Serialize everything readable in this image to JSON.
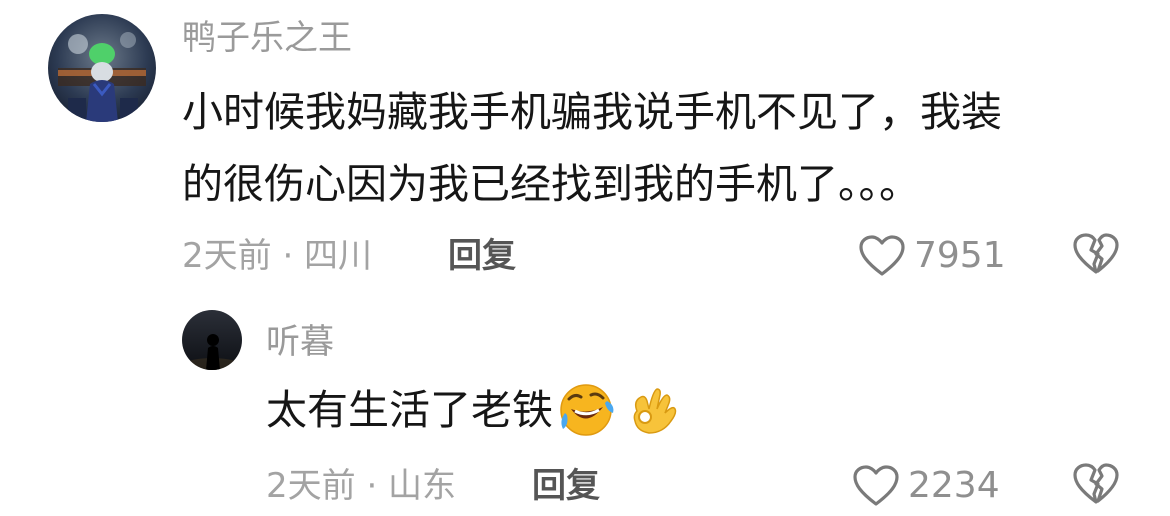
{
  "comments": [
    {
      "username": "鸭子乐之王",
      "text_line1": "小时候我妈藏我手机骗我说手机不见了，我装",
      "text_line2": "的很伤心因为我已经找到我的手机了。。。",
      "meta": "2天前 · 四川",
      "reply_label": "回复",
      "likes": "7951",
      "avatar_icon": "avatar-figure-icon"
    },
    {
      "username": "听暮",
      "text": "太有生活了老铁",
      "emojis": [
        "rofl-emoji",
        "ok-hand-emoji"
      ],
      "meta": "2天前 · 山东",
      "reply_label": "回复",
      "likes": "2234",
      "avatar_icon": "avatar-silhouette-icon"
    }
  ],
  "colors": {
    "username": "#9a9a9a",
    "content": "#161616",
    "meta": "#a3a3a3",
    "reply": "#555555",
    "icon_stroke": "#7a7a7a"
  }
}
